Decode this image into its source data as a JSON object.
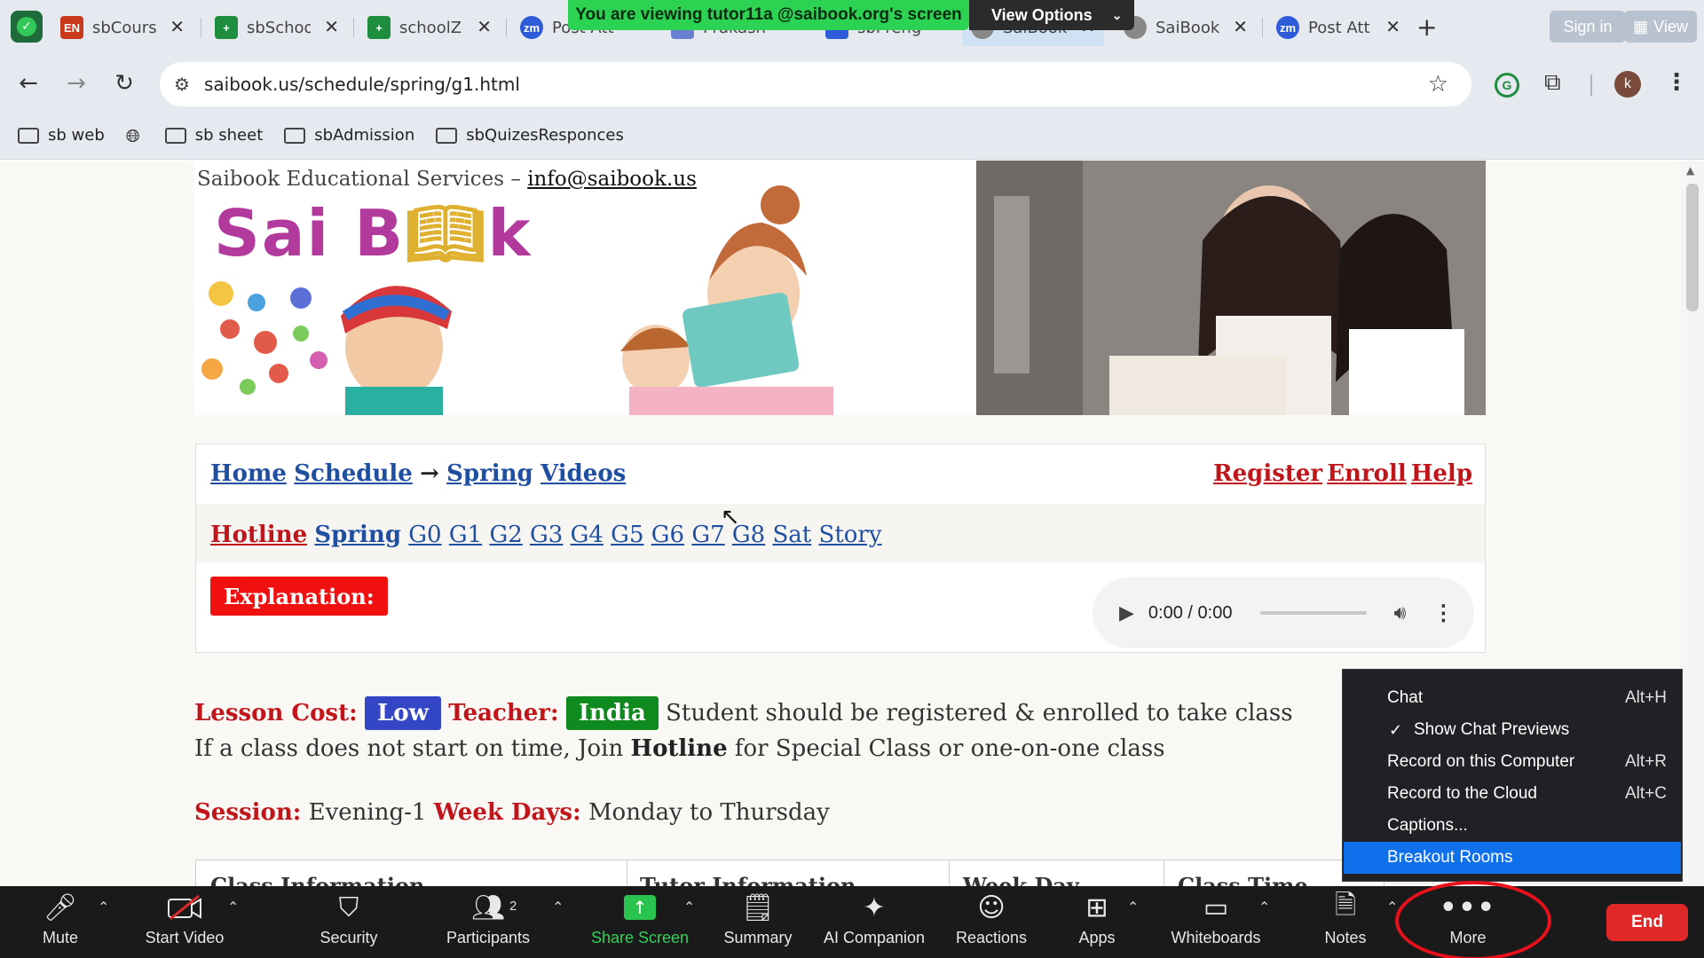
{
  "browser": {
    "tabs": [
      {
        "label": "sbCours",
        "icon": "EN",
        "icon_color": "#c93a1d"
      },
      {
        "label": "sbSchoo",
        "icon": "+",
        "icon_color": "#1e8e3e"
      },
      {
        "label": "schoolZ",
        "icon": "+",
        "icon_color": "#1e8e3e"
      },
      {
        "label": "Post Att",
        "icon": "zm",
        "icon_color": "#2d5bd9"
      },
      {
        "label": "Prakash",
        "icon": "",
        "icon_color": "#6a7fd0"
      },
      {
        "label": "sbPreng",
        "icon": "",
        "icon_color": "#2d5bd9"
      },
      {
        "label": "SaiBook",
        "icon": "",
        "icon_color": "#666666"
      },
      {
        "label": "SaiBook",
        "icon": "",
        "icon_color": "#666666"
      },
      {
        "label": "Post Att",
        "icon": "zm",
        "icon_color": "#2d5bd9"
      }
    ],
    "new_tab_label": "+",
    "sign_in_label": "Sign in",
    "view_label": "View",
    "url": "saibook.us/schedule/spring/g1.html",
    "profile_initial": "k",
    "bookmarks": [
      {
        "label": "sb web",
        "type": "folder"
      },
      {
        "label": "",
        "type": "globe"
      },
      {
        "label": "sb sheet",
        "type": "folder"
      },
      {
        "label": "sbAdmission",
        "type": "folder"
      },
      {
        "label": "sbQuizesResponces",
        "type": "folder"
      }
    ]
  },
  "share_banner": {
    "text": "You are viewing tutor11a @saibook.org's screen",
    "view_options_label": "View Options"
  },
  "page": {
    "org_prefix": "Saibook Educational Services – ",
    "org_email": "info@saibook.us",
    "logo_text": "Sai Book",
    "nav_row1_left": [
      {
        "label": "Home",
        "color": "blue"
      },
      {
        "label": "Schedule",
        "color": "blue"
      },
      {
        "label": "→",
        "color": "plain"
      },
      {
        "label": "Spring",
        "color": "blue"
      },
      {
        "label": "Videos",
        "color": "blue"
      }
    ],
    "nav_row1_right": [
      "Register",
      "Enroll",
      "Help"
    ],
    "nav_row2": {
      "hotline": "Hotline",
      "spring": "Spring",
      "grades": [
        "G0",
        "G1",
        "G2",
        "G3",
        "G4",
        "G5",
        "G6",
        "G7",
        "G8",
        "Sat",
        "Story"
      ]
    },
    "explanation_label": "Explanation:",
    "audio_time": "0:00 / 0:00",
    "lesson_cost_label": "Lesson Cost:",
    "lesson_cost_value": "Low",
    "teacher_label": "Teacher:",
    "teacher_value": "India",
    "enroll_note": "Student should be registered & enrolled to take class",
    "hotline_note_prefix": "If a class does not start on time, Join ",
    "hotline_note_bold": "Hotline",
    "hotline_note_suffix": " for Special Class or one-on-one class",
    "session_label": "Session:",
    "session_value": "Evening-1",
    "weekdays_label": "Week Days:",
    "weekdays_value": "Monday to Thursday",
    "table_headers": [
      "Class Information",
      "Tutor Information",
      "Week Day",
      "Class Time"
    ]
  },
  "more_menu": {
    "items": [
      {
        "label": "Chat",
        "shortcut": "Alt+H",
        "checked": false,
        "selected": false
      },
      {
        "label": "Show Chat Previews",
        "shortcut": "",
        "checked": true,
        "selected": false
      },
      {
        "label": "Record on this Computer",
        "shortcut": "Alt+R",
        "checked": false,
        "selected": false
      },
      {
        "label": "Record to the Cloud",
        "shortcut": "Alt+C",
        "checked": false,
        "selected": false
      },
      {
        "label": "Captions...",
        "shortcut": "",
        "checked": false,
        "selected": false
      },
      {
        "label": "Breakout Rooms",
        "shortcut": "",
        "checked": false,
        "selected": true
      }
    ]
  },
  "zoom_bar": {
    "mute": "Mute",
    "start_video": "Start Video",
    "security": "Security",
    "participants": "Participants",
    "participants_count": "2",
    "share_screen": "Share Screen",
    "summary": "Summary",
    "ai_companion": "AI Companion",
    "reactions": "Reactions",
    "apps": "Apps",
    "whiteboards": "Whiteboards",
    "notes": "Notes",
    "more": "More",
    "end": "End"
  },
  "colors": {
    "share_green": "#2cd353",
    "menu_selected": "#0e71eb",
    "end_red": "#e02828",
    "link_blue": "#1f4fa1",
    "link_red": "#c0161b"
  }
}
